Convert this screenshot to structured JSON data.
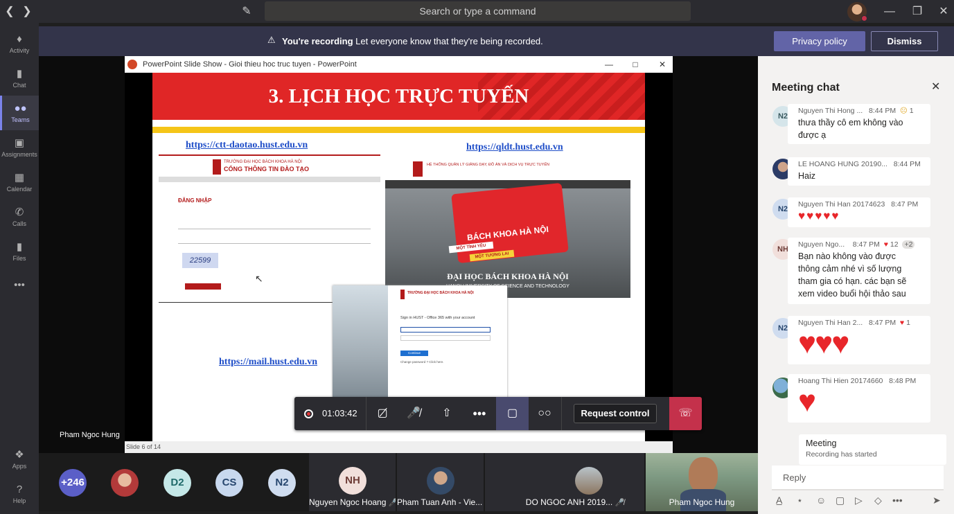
{
  "titlebar": {
    "search_placeholder": "Search or type a command"
  },
  "rail": {
    "items": [
      {
        "label": "Activity",
        "icon": "bell-icon"
      },
      {
        "label": "Chat",
        "icon": "chat-icon"
      },
      {
        "label": "Teams",
        "icon": "teams-icon"
      },
      {
        "label": "Assignments",
        "icon": "assignments-icon"
      },
      {
        "label": "Calendar",
        "icon": "calendar-icon"
      },
      {
        "label": "Calls",
        "icon": "phone-icon"
      },
      {
        "label": "Files",
        "icon": "file-icon"
      },
      {
        "label": "Apps",
        "icon": "apps-icon"
      },
      {
        "label": "Help",
        "icon": "help-icon"
      }
    ]
  },
  "banner": {
    "bold": "You're recording",
    "text": "Let everyone know that they're being recorded.",
    "privacy_label": "Privacy policy",
    "dismiss_label": "Dismiss"
  },
  "ppt": {
    "window_title": "PowerPoint Slide Show  -  Gioi thieu hoc truc tuyen - PowerPoint",
    "heading": "3. LỊCH HỌC TRỰC TUYẾN",
    "link1": "https://ctt-daotao.hust.edu.vn",
    "link2": "https://qldt.hust.edu.vn",
    "link3": "https://mail.hust.edu.vn",
    "shot1_title": "TRƯỜNG ĐẠI HỌC BÁCH KHOA HÀ NỘI",
    "shot1_sub": "CỔNG THÔNG TIN ĐÀO TẠO",
    "shot1_login": "ĐĂNG NHẬP",
    "shot1_captcha": "22599",
    "shot2_title": "HỆ THỐNG QUẢN LÝ GIẢNG DẠY, ĐỒ ÁN VÀ DỊCH VỤ TRỰC TUYẾN",
    "shot2_banner": "BÁCH KHOA HÀ NỘI",
    "shot2_line1": "MỘT TÌNH YÊU",
    "shot2_line2": "MỘT TƯƠNG LAI",
    "shot2_caption": "ĐẠI HỌC BÁCH KHOA HÀ NỘI",
    "shot2_caption_en": "HANOI UNIVERSITY OF SCIENCE AND TECHNOLOGY",
    "shot3_title": "TRƯỜNG ĐẠI HỌC BÁCH KHOA HÀ NỘI",
    "shot3_sign": "Sign in HUST - Office 365 with your account",
    "shot3_button": "Continue",
    "shot3_change": "Change password ? Click here.",
    "status": "Slide 6 of 14"
  },
  "controls": {
    "timer": "01:03:42",
    "request_label": "Request control"
  },
  "presenter_label": "Pham Ngoc Hung",
  "participants": {
    "overflow": "+246",
    "avatars": [
      {
        "initials": "",
        "color": "#b33a3a"
      },
      {
        "initials": "D2",
        "color": "#c5e8e8"
      },
      {
        "initials": "CS",
        "color": "#c8d8ee"
      },
      {
        "initials": "N2",
        "color": "#cfdcef"
      }
    ],
    "tiles": [
      {
        "initials": "NH",
        "name": "Nguyen Ngoc Hoang"
      },
      {
        "initials": "",
        "name": "Pham Tuan Anh - Vie..."
      },
      {
        "initials": "",
        "name": "DO NGOC ANH 2019..."
      },
      {
        "initials": "",
        "name": "Pham Ngoc Hung"
      }
    ]
  },
  "chat": {
    "title": "Meeting chat",
    "messages": [
      {
        "avatar": "N2",
        "name": "Nguyen Thi Hong ...",
        "time": "8:44 PM",
        "reaction": "1",
        "text": "thưa thầy cô em không vào được ạ"
      },
      {
        "avatar": "",
        "name": "LE HOANG HUNG 20190...",
        "time": "8:44 PM",
        "text": "Haiz"
      },
      {
        "avatar": "N2",
        "name": "Nguyen Thi Han 20174623",
        "time": "8:47 PM",
        "text": "♥♥♥♥♥"
      },
      {
        "avatar": "NH",
        "name": "Nguyen Ngo...",
        "time": "8:47 PM",
        "reaction": "12",
        "extra": "+2",
        "text": "Bạn nào không vào được thông cảm nhé vì số lượng tham gia có hạn. các bạn sẽ xem video buổi hội thảo sau"
      },
      {
        "avatar": "N2",
        "name": "Nguyen Thi Han 2...",
        "time": "8:47 PM",
        "reaction": "1",
        "text": "♥♥♥"
      },
      {
        "avatar": "",
        "name": "Hoang Thi Hien 20174660",
        "time": "8:48 PM",
        "text": "♥"
      }
    ],
    "system_title": "Meeting",
    "system_text": "Recording has started",
    "reply_placeholder": "Reply"
  }
}
